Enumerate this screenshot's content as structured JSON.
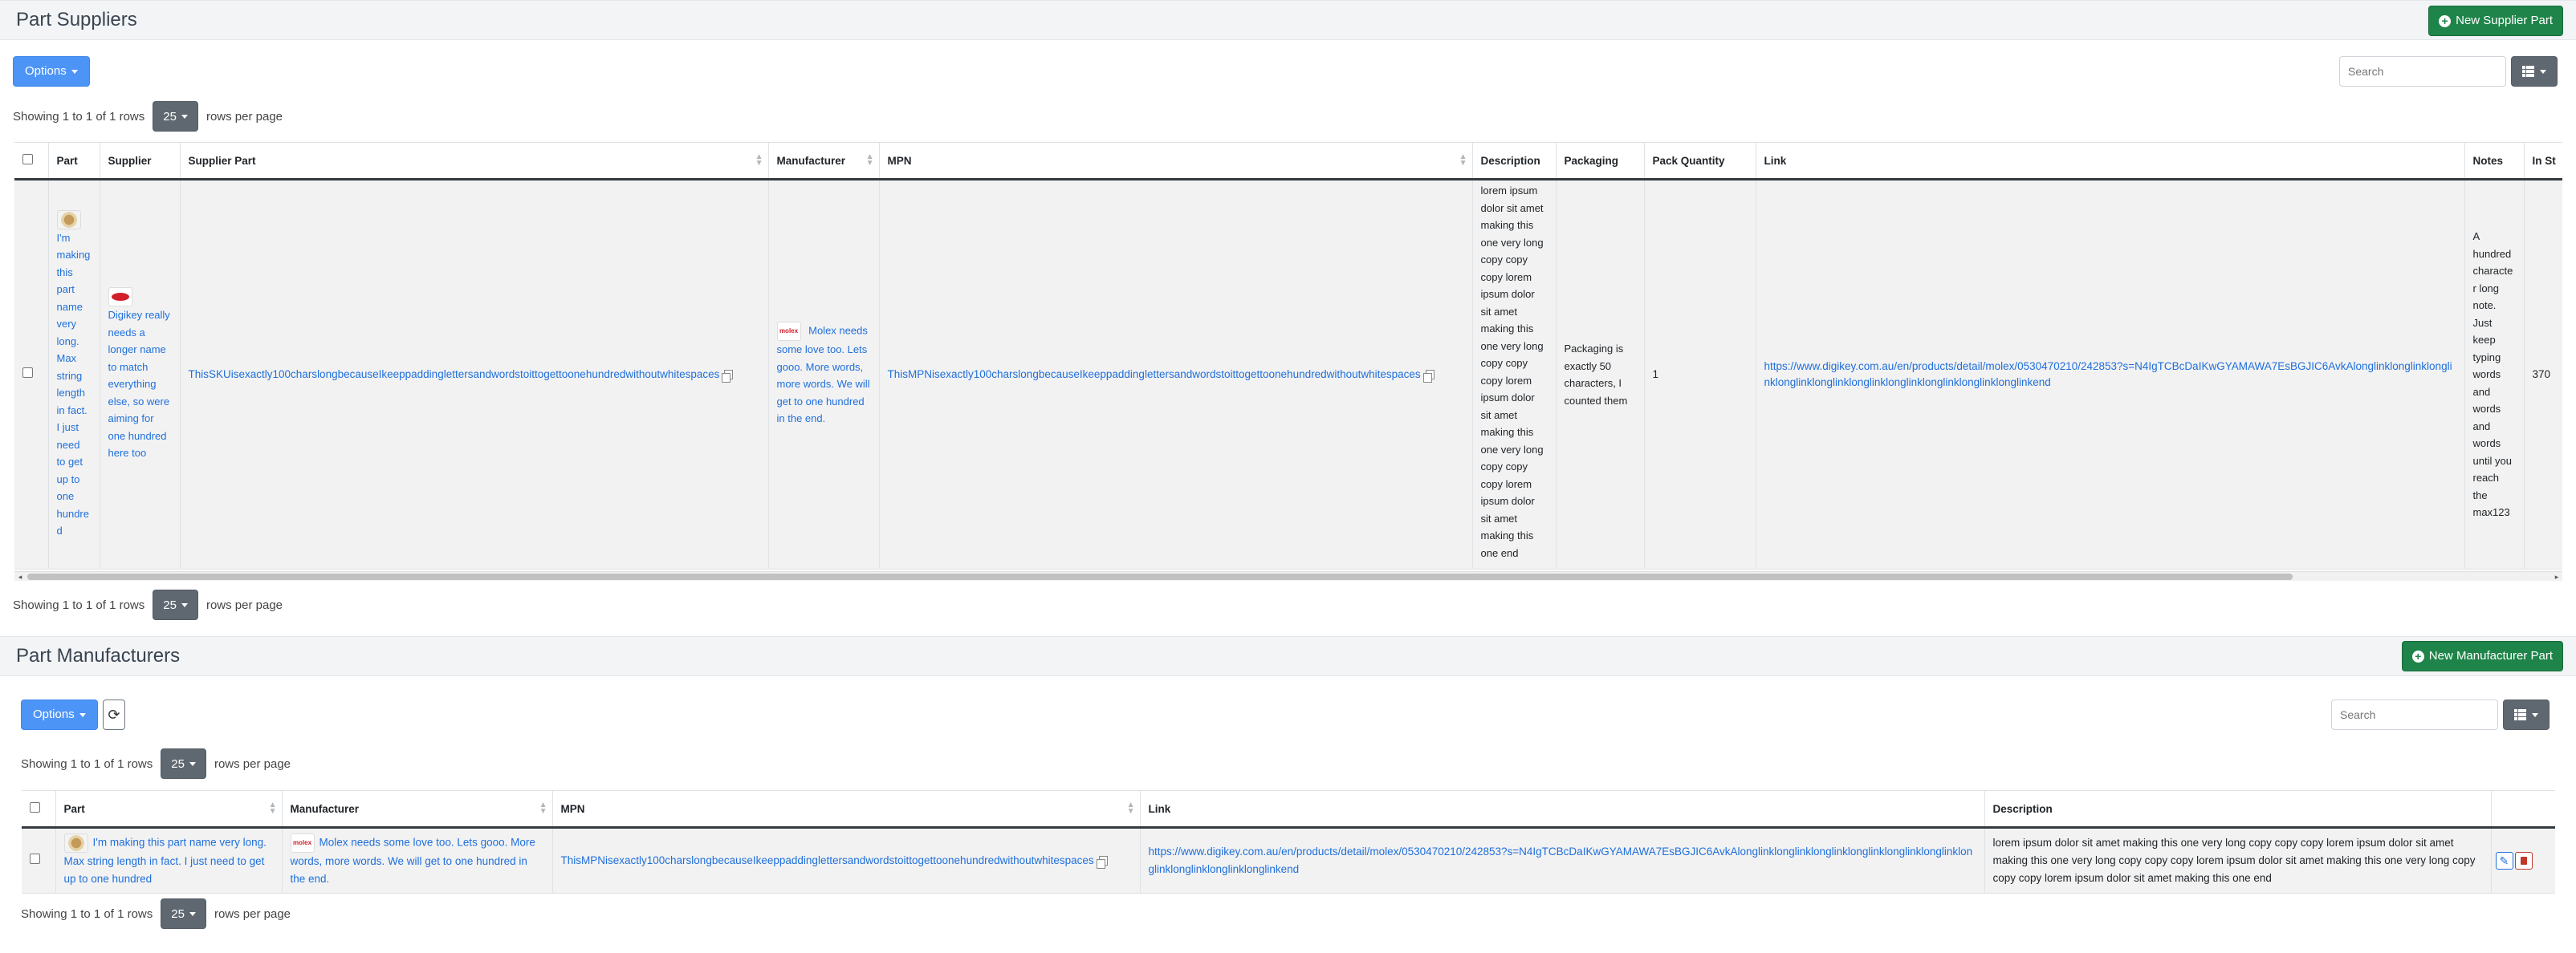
{
  "suppliers_section": {
    "title": "Part Suppliers",
    "new_button": "New Supplier Part",
    "options_label": "Options",
    "search_placeholder": "Search",
    "showing_text": "Showing 1 to 1 of 1 rows",
    "page_size": "25",
    "rows_per_page": "rows per page",
    "columns": [
      "Part",
      "Supplier",
      "Supplier Part",
      "Manufacturer",
      "MPN",
      "Description",
      "Packaging",
      "Pack Quantity",
      "Link",
      "Notes",
      "In St"
    ],
    "row": {
      "part": "I'm making this part name very long. Max string length in fact. I just need to get up to one hundred",
      "supplier": "Digikey really needs a longer name to match everything else, so were aiming for one hundred here too",
      "supplier_part": "ThisSKUisexactly100charslongbecauseIkeeppaddinglettersandwordstoittogettoonehundredwithoutwhitespaces",
      "manufacturer": "Molex needs some love too. Lets gooo. More words, more words. We will get to one hundred in the end.",
      "mpn": "ThisMPNisexactly100charslongbecauseIkeeppaddinglettersandwordstoittogettoonehundredwithoutwhitespaces",
      "description": "lorem ipsum dolor sit amet making this one very long copy copy copy lorem ipsum dolor sit amet making this one very long copy copy copy lorem ipsum dolor sit amet making this one very long copy copy copy lorem ipsum dolor sit amet making this one end",
      "packaging": "Packaging is exactly 50 characters, I counted them",
      "pack_quantity": "1",
      "link": "https://www.digikey.com.au/en/products/detail/molex/0530470210/242853?s=N4IgTCBcDaIKwGYAMAWA7EsBGJIC6AvkAlonglinklonglinklonglinklonglinklonglinklonglinklonglinklonglinklonglinklonglinkend",
      "notes": "A hundred character long note. Just keep typing words and words and words until you reach the max123",
      "in_stock": "370"
    }
  },
  "manufacturers_section": {
    "title": "Part Manufacturers",
    "new_button": "New Manufacturer Part",
    "options_label": "Options",
    "search_placeholder": "Search",
    "showing_text": "Showing 1 to 1 of 1 rows",
    "page_size": "25",
    "rows_per_page": "rows per page",
    "columns": [
      "Part",
      "Manufacturer",
      "MPN",
      "Link",
      "Description"
    ],
    "row": {
      "part": "I'm making this part name very long. Max string length in fact. I just need to get up to one hundred",
      "manufacturer": "Molex needs some love too. Lets gooo. More words, more words. We will get to one hundred in the end.",
      "mpn": "ThisMPNisexactly100charslongbecauseIkeeppaddinglettersandwordstoittogettoonehundredwithoutwhitespaces",
      "link": "https://www.digikey.com.au/en/products/detail/molex/0530470210/242853?s=N4IgTCBcDaIKwGYAMAWA7EsBGJIC6AvkAlonglinklonglinklonglinklonglinklonglinklonglinklonglinklonglinklonglinklonglinkend",
      "description": "lorem ipsum dolor sit amet making this one very long copy copy copy lorem ipsum dolor sit amet making this one very long copy copy copy lorem ipsum dolor sit amet making this one very long copy copy copy lorem ipsum dolor sit amet making this one end"
    }
  },
  "logo_text": {
    "molex": "molex"
  },
  "icons": {
    "new_button": "plus-circle-icon",
    "refresh": "refresh-icon",
    "columns": "grid-icon",
    "copy": "copy-icon",
    "edit": "edit-icon",
    "delete": "trash-icon"
  },
  "colors": {
    "accent_green": "#1e8449",
    "options_blue": "#4d94f7",
    "link_blue": "#1f6fdc",
    "dark_button": "#5f6770"
  }
}
